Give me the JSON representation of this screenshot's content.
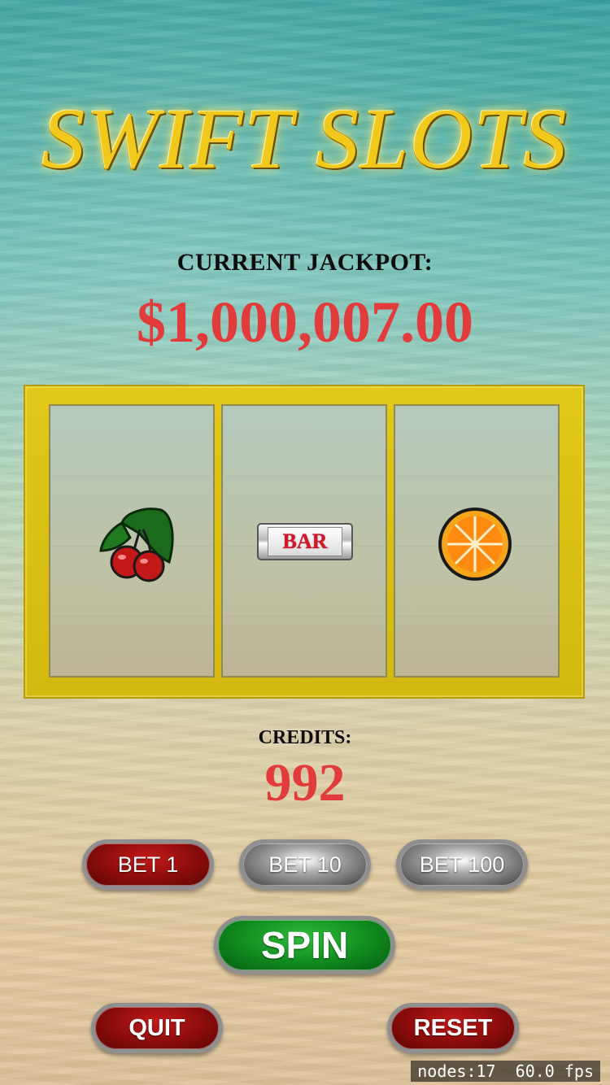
{
  "title": "SWIFT SLOTS",
  "jackpot": {
    "label": "CURRENT JACKPOT:",
    "value": "$1,000,007.00"
  },
  "reels": [
    {
      "symbol": "cherry-icon"
    },
    {
      "symbol": "bar-icon",
      "text": "BAR"
    },
    {
      "symbol": "orange-icon"
    }
  ],
  "credits": {
    "label": "CREDITS:",
    "value": "992"
  },
  "buttons": {
    "bet1": "BET 1",
    "bet10": "BET 10",
    "bet100": "BET 100",
    "spin": "SPIN",
    "quit": "QUIT",
    "reset": "RESET"
  },
  "debug": {
    "text": "nodes:17  60.0 fps"
  },
  "colors": {
    "title_gold": "#f1c91c",
    "accent_red": "#e23b3b",
    "frame_yellow": "#e2c81a",
    "button_red": "#8a0c0c",
    "button_green": "#108a1e",
    "button_grey": "#a9a9a9"
  }
}
